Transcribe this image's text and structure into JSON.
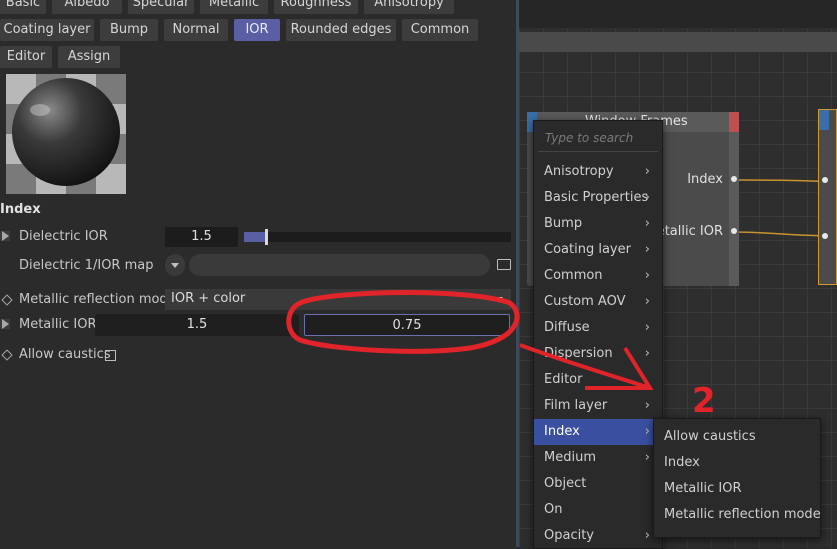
{
  "tabs_row1": [
    "Basic",
    "Albedo",
    "Specular",
    "Metallic",
    "Roughness",
    "Anisotropy"
  ],
  "tabs_row2": [
    "Coating layer",
    "Bump",
    "Normal",
    "IOR",
    "Rounded edges",
    "Common"
  ],
  "tabs_row3": [
    "Editor",
    "Assign"
  ],
  "active_tab": "IOR",
  "section_title": "Index",
  "params": {
    "dielectric_ior_label": "Dielectric IOR",
    "dielectric_ior_value": "1.5",
    "dielectric_ior_slider_fraction": 0.08,
    "dielectric_map_label": "Dielectric 1/IOR map",
    "metallic_mode_label": "Metallic reflection mode",
    "metallic_mode_value": "IOR + color",
    "metallic_ior_label": "Metallic IOR",
    "metallic_ior_value1": "1.5",
    "metallic_ior_value2": "0.75",
    "allow_caustics_label": "Allow caustics"
  },
  "node": {
    "title": "Window Frames",
    "port1": "Index",
    "port2": "Metallic IOR"
  },
  "context_menu": {
    "search_placeholder": "Type to search",
    "items": [
      {
        "label": "Anisotropy",
        "sub": true
      },
      {
        "label": "Basic Properties",
        "sub": true
      },
      {
        "label": "Bump",
        "sub": true
      },
      {
        "label": "Coating layer",
        "sub": true
      },
      {
        "label": "Common",
        "sub": true
      },
      {
        "label": "Custom AOV",
        "sub": true
      },
      {
        "label": "Diffuse",
        "sub": true
      },
      {
        "label": "Dispersion",
        "sub": true
      },
      {
        "label": "Editor",
        "sub": false
      },
      {
        "label": "Film layer",
        "sub": true
      },
      {
        "label": "Index",
        "sub": true
      },
      {
        "label": "Medium",
        "sub": true
      },
      {
        "label": "Object",
        "sub": false
      },
      {
        "label": "On",
        "sub": false
      },
      {
        "label": "Opacity",
        "sub": true
      }
    ],
    "highlighted": "Index"
  },
  "submenu": {
    "items": [
      "Allow caustics",
      "Index",
      "Metallic IOR",
      "Metallic reflection mode"
    ]
  },
  "annotation": {
    "number": "2",
    "color": "#e0242a"
  },
  "colors": {
    "accent": "#5a5fa3",
    "highlight": "#3b4fa0",
    "wire": "#c8922e"
  }
}
